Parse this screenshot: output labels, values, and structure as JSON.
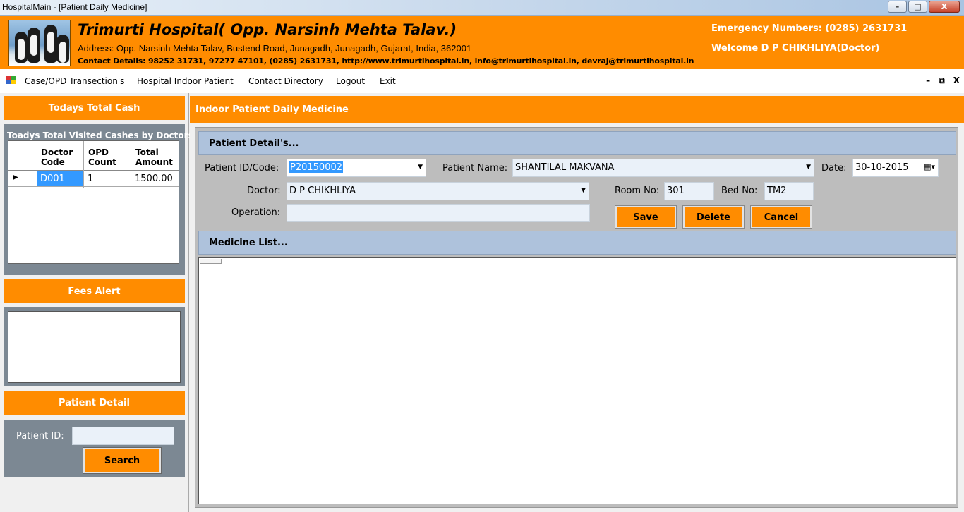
{
  "window": {
    "title": "HospitalMain - [Patient Daily Medicine]",
    "controls": [
      "–",
      "□",
      "X"
    ]
  },
  "header": {
    "hospital_name": "Trimurti Hospital( Opp. Narsinh Mehta Talav.)",
    "address": "Address: Opp. Narsinh Mehta Talav, Bustend Road, Junagadh, Junagadh, Gujarat, India, 362001",
    "contact": "Contact Details: 98252 31731, 97277 47101, (0285) 2631731, http://www.trimurtihospital.in, info@trimurtihospital.in, devraj@trimurtihospital.in",
    "emergency": "Emergency Numbers: (0285) 2631731",
    "welcome": "Welcome D P CHIKHLIYA(Doctor)"
  },
  "menu": {
    "items": [
      "Case/OPD Transection's",
      "Hospital Indoor Patient",
      "Contact Directory",
      "Logout",
      "Exit"
    ],
    "mdi_controls": [
      "–",
      "⧉",
      "X"
    ]
  },
  "left": {
    "todays_total_cash": "Todays Total Cash",
    "visited_title": "Toadys Total Visited Cashes by Doctors",
    "grid": {
      "headers": [
        "Doctor\nCode",
        "OPD\nCount",
        "Total\nAmount"
      ],
      "rows": [
        [
          "D001",
          "1",
          "1500.00"
        ]
      ]
    },
    "fees_alert": "Fees Alert",
    "patient_detail": "Patient Detail",
    "patient_id_label": "Patient ID:",
    "patient_id_value": "",
    "search_label": "Search"
  },
  "form": {
    "title": "Indoor Patient Daily Medicine",
    "patient_section": "Patient Detail's...",
    "patient_id_label": "Patient ID/Code:",
    "patient_id_value": "P20150002",
    "patient_name_label": "Patient Name:",
    "patient_name_value": "SHANTILAL MAKVANA",
    "date_label": "Date:",
    "date_value": "30-10-2015",
    "doctor_label": "Doctor:",
    "doctor_value": "D P CHIKHLIYA",
    "room_label": "Room No:",
    "room_value": "301",
    "bed_label": "Bed No:",
    "bed_value": "TM2",
    "operation_label": "Operation:",
    "operation_value": "",
    "save_label": "Save",
    "delete_label": "Delete",
    "cancel_label": "Cancel",
    "medicine_section": "Medicine List..."
  },
  "colors": {
    "accent": "#ff8c00",
    "section_bar": "#aec2dc",
    "panel_gray": "#7c8893",
    "selection": "#3399ff"
  }
}
